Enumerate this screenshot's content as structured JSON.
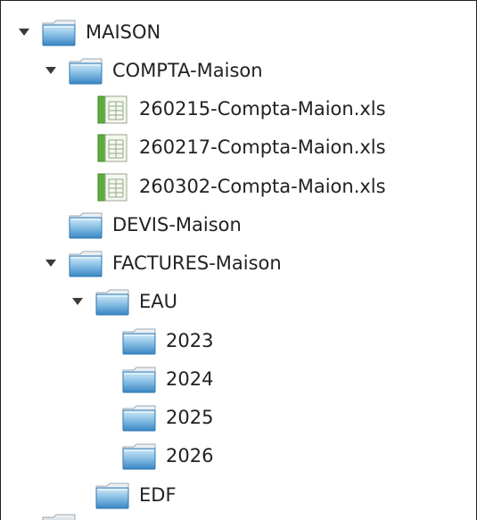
{
  "tree": {
    "root": {
      "label": "MAISON",
      "icon": "folder-icon",
      "expanded": true,
      "children": [
        {
          "label": "COMPTA-Maison",
          "icon": "folder-icon",
          "expanded": true,
          "children": [
            {
              "label": "260215-Compta-Maion.xls",
              "icon": "spreadsheet-icon"
            },
            {
              "label": "260217-Compta-Maion.xls",
              "icon": "spreadsheet-icon"
            },
            {
              "label": "260302-Compta-Maion.xls",
              "icon": "spreadsheet-icon"
            }
          ]
        },
        {
          "label": "DEVIS-Maison",
          "icon": "folder-icon",
          "expanded": false
        },
        {
          "label": "FACTURES-Maison",
          "icon": "folder-icon",
          "expanded": true,
          "children": [
            {
              "label": "EAU",
              "icon": "folder-icon",
              "expanded": true,
              "children": [
                {
                  "label": "2023",
                  "icon": "folder-icon"
                },
                {
                  "label": "2024",
                  "icon": "folder-icon"
                },
                {
                  "label": "2025",
                  "icon": "folder-icon"
                },
                {
                  "label": "2026",
                  "icon": "folder-icon"
                }
              ]
            },
            {
              "label": "EDF",
              "icon": "folder-icon",
              "expanded": false
            }
          ]
        }
      ]
    }
  },
  "colors": {
    "folder_top": "#c9e5f6",
    "folder_bottom": "#3f8fc8",
    "folder_tab": "#e8eef3",
    "sheet_accent": "#5cae3c",
    "sheet_grid": "#7aa36b",
    "arrow": "#3a3a3a",
    "text": "#222222"
  }
}
